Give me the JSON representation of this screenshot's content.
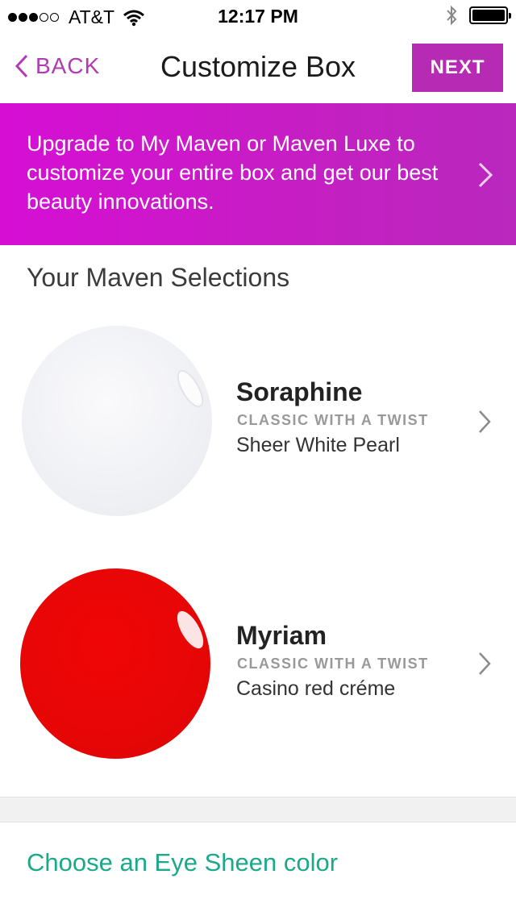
{
  "status_bar": {
    "carrier": "AT&T",
    "time": "12:17 PM",
    "signal_bars_filled": 3,
    "signal_bars_total": 5,
    "battery_level": 1.0
  },
  "nav": {
    "back_label": "BACK",
    "title": "Customize Box",
    "next_label": "NEXT"
  },
  "banner": {
    "text": "Upgrade to My Maven or Maven Luxe to customize your entire box and get our best beauty innovations."
  },
  "section_title": "Your Maven Selections",
  "products": [
    {
      "name": "Soraphine",
      "category": "CLASSIC WITH A TWIST",
      "description": "Sheer White Pearl",
      "swatch_color": "#eeeff3"
    },
    {
      "name": "Myriam",
      "category": "CLASSIC WITH A TWIST",
      "description": "Casino red créme",
      "swatch_color": "#e60606"
    }
  ],
  "footer": {
    "link_text": "Choose an Eye Sheen color"
  },
  "colors": {
    "accent": "#b62ab4",
    "banner": "#d60ed4",
    "link": "#1aa98a"
  },
  "icons": [
    "wifi-icon",
    "bluetooth-icon",
    "battery-icon",
    "back-chevron-icon",
    "chevron-right-icon"
  ]
}
